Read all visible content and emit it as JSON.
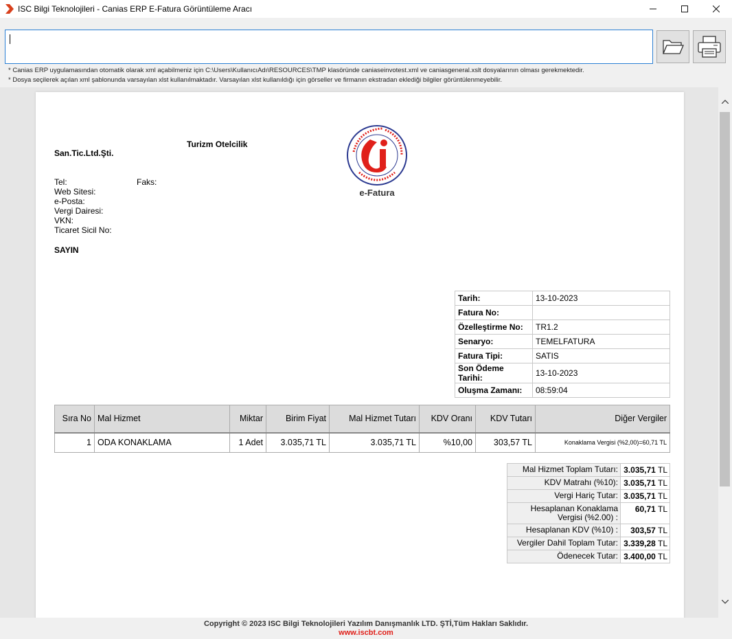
{
  "window": {
    "title": "ISC Bilgi Teknolojileri - Canias ERP E-Fatura Görüntüleme Aracı",
    "minimize_icon": "minimize-icon",
    "maximize_icon": "maximize-icon",
    "close_icon": "close-icon"
  },
  "toolbar": {
    "path_value": "",
    "open_icon": "folder-open-icon",
    "print_icon": "printer-icon"
  },
  "notes": {
    "line1": "* Canias ERP uygulamasından otomatik olarak xml açabilmeniz için C:\\Users\\KullanıcıAdı\\RESOURCES\\TMP klasöründe caniaseinvotest.xml ve caniasgeneral.xslt dosyalarının olması gerekmektedir.",
    "line2": "* Dosya seçilerek açılan xml şablonunda varsayılan xlst kullanılmaktadır. Varsayılan xlst kullanıldığı için görseller ve firmanın ekstradan eklediği bilgiler görüntülenmeyebilir."
  },
  "invoice": {
    "company_name": "San.Tic.Ltd.Şti.",
    "company_sector": "Turizm Otelcilik",
    "logo_label": "e-Fatura",
    "logo_ring_text": "T.C. Hazine ve Maliye Bakanlığı · Gelir İdaresi Başkanlığı",
    "contact": {
      "tel": "Tel:",
      "fax": "Faks:",
      "web": "Web Sitesi:",
      "email": "e-Posta:",
      "tax_office": "Vergi Dairesi:",
      "vkn": "VKN:",
      "trade_reg": "Ticaret Sicil No:"
    },
    "sayin": "SAYIN",
    "info": [
      {
        "key": "Tarih:",
        "value": "13-10-2023"
      },
      {
        "key": "Fatura No:",
        "value": ""
      },
      {
        "key": "Özelleştirme No:",
        "value": "TR1.2"
      },
      {
        "key": "Senaryo:",
        "value": "TEMELFATURA"
      },
      {
        "key": "Fatura Tipi:",
        "value": "SATIS"
      },
      {
        "key": "Son Ödeme Tarihi:",
        "value": "13-10-2023"
      },
      {
        "key": "Oluşma Zamanı:",
        "value": "08:59:04"
      }
    ],
    "items_headers": [
      "Sıra No",
      "Mal Hizmet",
      "Miktar",
      "Birim Fiyat",
      "Mal Hizmet Tutarı",
      "KDV Oranı",
      "KDV Tutarı",
      "Diğer Vergiler"
    ],
    "items": [
      {
        "sira": "1",
        "mal": "ODA KONAKLAMA",
        "miktar": "1 Adet",
        "birim": "3.035,71 TL",
        "tutar": "3.035,71 TL",
        "kdv_orani": "%10,00",
        "kdv_tutari": "303,57 TL",
        "diger": "Konaklama Vergisi (%2,00)=60,71 TL"
      }
    ],
    "totals": [
      {
        "key": "Mal Hizmet Toplam Tutarı:",
        "value": "3.035,71",
        "unit": "TL"
      },
      {
        "key": "KDV Matrahı (%10):",
        "value": "3.035,71",
        "unit": "TL"
      },
      {
        "key": "Vergi Hariç Tutar:",
        "value": "3.035,71",
        "unit": "TL"
      },
      {
        "key": "Hesaplanan Konaklama Vergisi (%2.00) :",
        "value": "60,71",
        "unit": "TL"
      },
      {
        "key": "Hesaplanan KDV (%10) :",
        "value": "303,57",
        "unit": "TL"
      },
      {
        "key": "Vergiler Dahil Toplam Tutar:",
        "value": "3.339,28",
        "unit": "TL"
      },
      {
        "key": "Ödenecek Tutar:",
        "value": "3.400,00",
        "unit": "TL"
      }
    ]
  },
  "footer": {
    "copyright": "Copyright © 2023 ISC Bilgi Teknolojileri Yazılım Danışmanlık LTD. ŞTİ,Tüm Hakları Saklıdır.",
    "website": "www.iscbt.com"
  },
  "colors": {
    "accent_border": "#2a7fd4",
    "logo_red": "#e0201a",
    "logo_blue": "#2b3990"
  }
}
